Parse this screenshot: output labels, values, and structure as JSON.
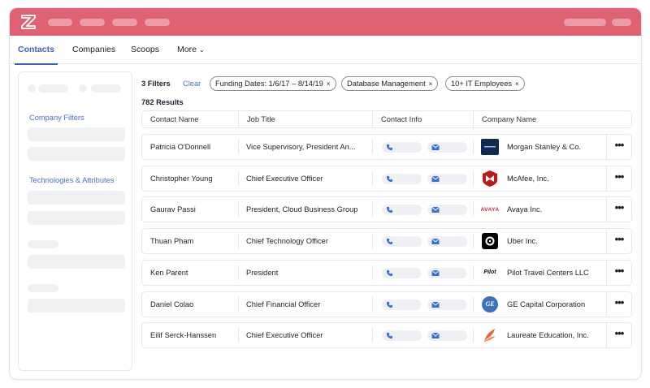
{
  "tabs": [
    {
      "label": "Contacts",
      "active": true
    },
    {
      "label": "Companies",
      "active": false
    },
    {
      "label": "Scoops",
      "active": false
    },
    {
      "label": "More",
      "active": false
    }
  ],
  "sidebar": {
    "company_filters_label": "Company Filters",
    "technologies_label": "Technologies & Attributes"
  },
  "filters": {
    "count_label": "3 Filters",
    "clear_label": "Clear",
    "chips": [
      "Funding Dates: 1/6/17 – 8/14/19",
      "Database Management",
      "10+ IT Employees"
    ],
    "remove_glyph": "×"
  },
  "results_label": "782  Results",
  "table": {
    "headers": [
      "Contact Name",
      "Job Title",
      "Contact Info",
      "Company Name"
    ],
    "more_glyph": "•••",
    "rows": [
      {
        "name": "Patricia O'Donnell",
        "title": "Vice Supervisory, President An...",
        "company": "Morgan Stanley & Co.",
        "logo": "morgan-stanley-logo"
      },
      {
        "name": "Christopher Young",
        "title": "Chief Executive Officer",
        "company": "McAfee, Inc.",
        "logo": "mcafee-logo"
      },
      {
        "name": "Gaurav Passi",
        "title": "President, Cloud Business Group",
        "company": "Avaya Inc.",
        "logo": "avaya-logo",
        "logo_text": "AVAYA"
      },
      {
        "name": "Thuan Pham",
        "title": "Chief Technology Officer",
        "company": "Uber Inc.",
        "logo": "uber-logo"
      },
      {
        "name": "Ken Parent",
        "title": "President",
        "company": "Pilot Travel Centers LLC",
        "logo": "pilot-logo",
        "logo_text": "Pilot"
      },
      {
        "name": "Daniel Colao",
        "title": "Chief Financial Officer",
        "company": "GE Capital Corporation",
        "logo": "ge-logo",
        "logo_text": "GE"
      },
      {
        "name": "Eilif Serck-Hanssen",
        "title": "Chief Executive Officer",
        "company": "Laureate Education, Inc.",
        "logo": "laureate-logo"
      }
    ]
  },
  "colors": {
    "topbar": "#de6272",
    "accent": "#3b5fc4"
  }
}
